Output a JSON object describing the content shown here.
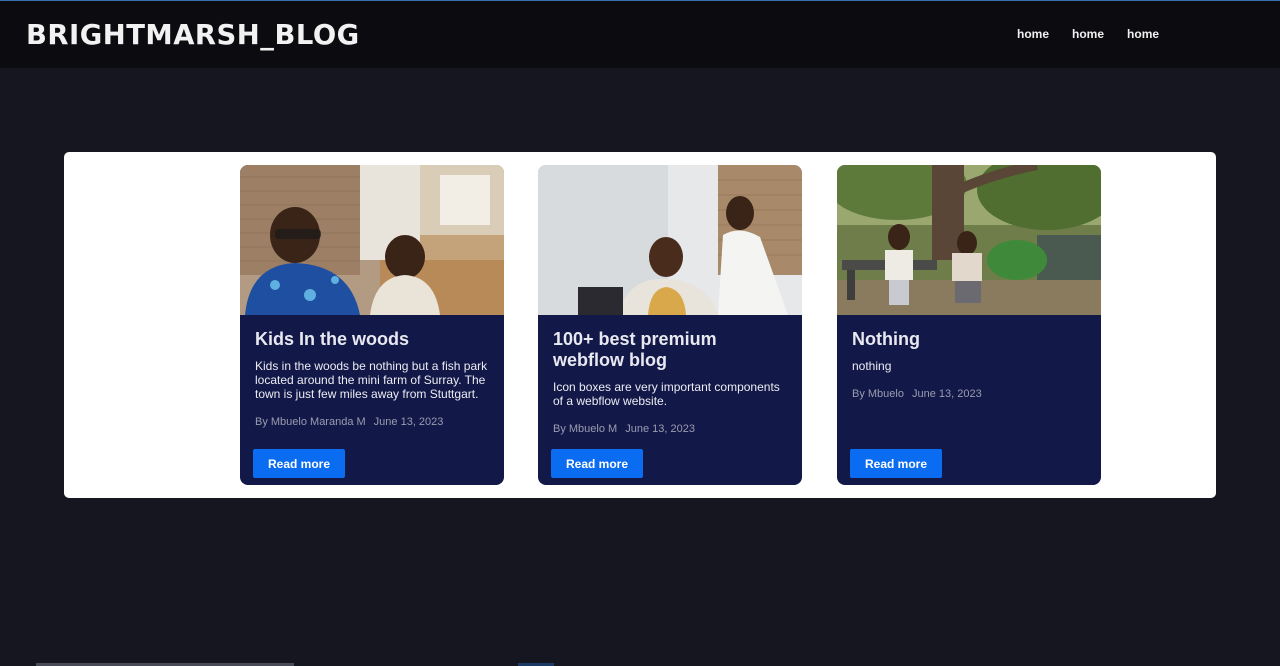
{
  "header": {
    "brand": "BRIGHTMARSH_BLOG",
    "nav": [
      "home",
      "home",
      "home"
    ]
  },
  "colors": {
    "background": "#15161f",
    "navbar": "#0b0b10",
    "card": "#121848",
    "button": "#0a6cf0",
    "panel": "#ffffff"
  },
  "posts": [
    {
      "image": "photo-kids-indoors",
      "title": "Kids In the woods",
      "excerpt": "Kids in the woods be nothing but a fish park located around the mini farm of Surray. The town is just few miles away from Stuttgart.",
      "author": "By Mbuelo Maranda M",
      "date": "June 13, 2023",
      "button": "Read more"
    },
    {
      "image": "photo-people-indoors",
      "title": "100+ best premium webflow blog",
      "excerpt": "Icon boxes are very important components of a webflow website.",
      "author": "By Mbuelo M",
      "date": "June 13, 2023",
      "button": "Read more"
    },
    {
      "image": "photo-park-bench",
      "title": "Nothing",
      "excerpt": "nothing",
      "author": "By Mbuelo",
      "date": "June 13, 2023",
      "button": "Read more"
    }
  ]
}
